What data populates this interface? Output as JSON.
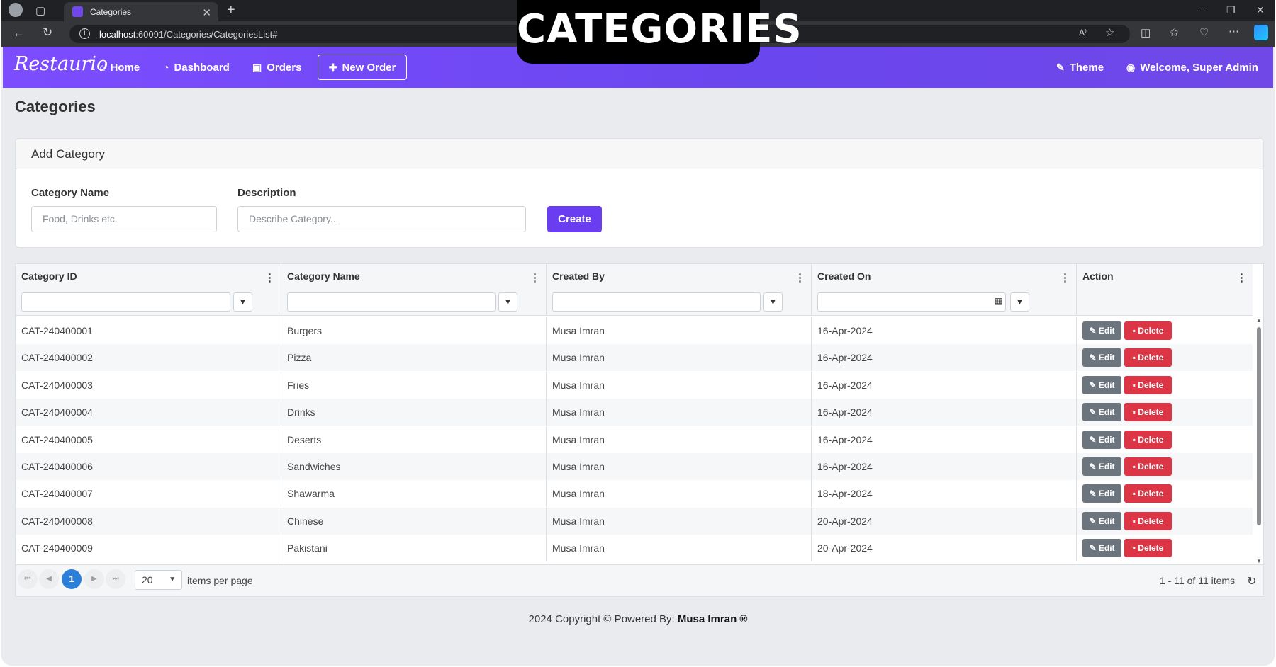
{
  "overlay_title": "CATEGORIES",
  "browser": {
    "tab_title": "Categories",
    "url_host": "localhost",
    "url_rest": ":60091/Categories/CategoriesList#"
  },
  "navbar": {
    "brand": "Restaurio",
    "links": [
      "Home",
      "Dashboard",
      "Orders"
    ],
    "new_order": "New Order",
    "theme": "Theme",
    "welcome": "Welcome, Super Admin"
  },
  "page_title": "Categories",
  "add_category": {
    "header": "Add Category",
    "name_label": "Category Name",
    "name_placeholder": "Food, Drinks etc.",
    "desc_label": "Description",
    "desc_placeholder": "Describe Category...",
    "create": "Create"
  },
  "grid": {
    "columns": [
      "Category ID",
      "Category Name",
      "Created By",
      "Created On",
      "Action"
    ],
    "edit_label": "Edit",
    "delete_label": "Delete",
    "rows": [
      [
        "CAT-240400001",
        "Burgers",
        "Musa Imran",
        "16-Apr-2024"
      ],
      [
        "CAT-240400002",
        "Pizza",
        "Musa Imran",
        "16-Apr-2024"
      ],
      [
        "CAT-240400003",
        "Fries",
        "Musa Imran",
        "16-Apr-2024"
      ],
      [
        "CAT-240400004",
        "Drinks",
        "Musa Imran",
        "16-Apr-2024"
      ],
      [
        "CAT-240400005",
        "Deserts",
        "Musa Imran",
        "16-Apr-2024"
      ],
      [
        "CAT-240400006",
        "Sandwiches",
        "Musa Imran",
        "16-Apr-2024"
      ],
      [
        "CAT-240400007",
        "Shawarma",
        "Musa Imran",
        "18-Apr-2024"
      ],
      [
        "CAT-240400008",
        "Chinese",
        "Musa Imran",
        "20-Apr-2024"
      ],
      [
        "CAT-240400009",
        "Pakistani",
        "Musa Imran",
        "20-Apr-2024"
      ]
    ],
    "pager": {
      "current_page": "1",
      "page_size": "20",
      "items_per_page": "items per page",
      "summary": "1 - 11 of 11 items"
    }
  },
  "footer": {
    "text": "2024 Copyright © Powered By: ",
    "author": "Musa Imran ®"
  }
}
